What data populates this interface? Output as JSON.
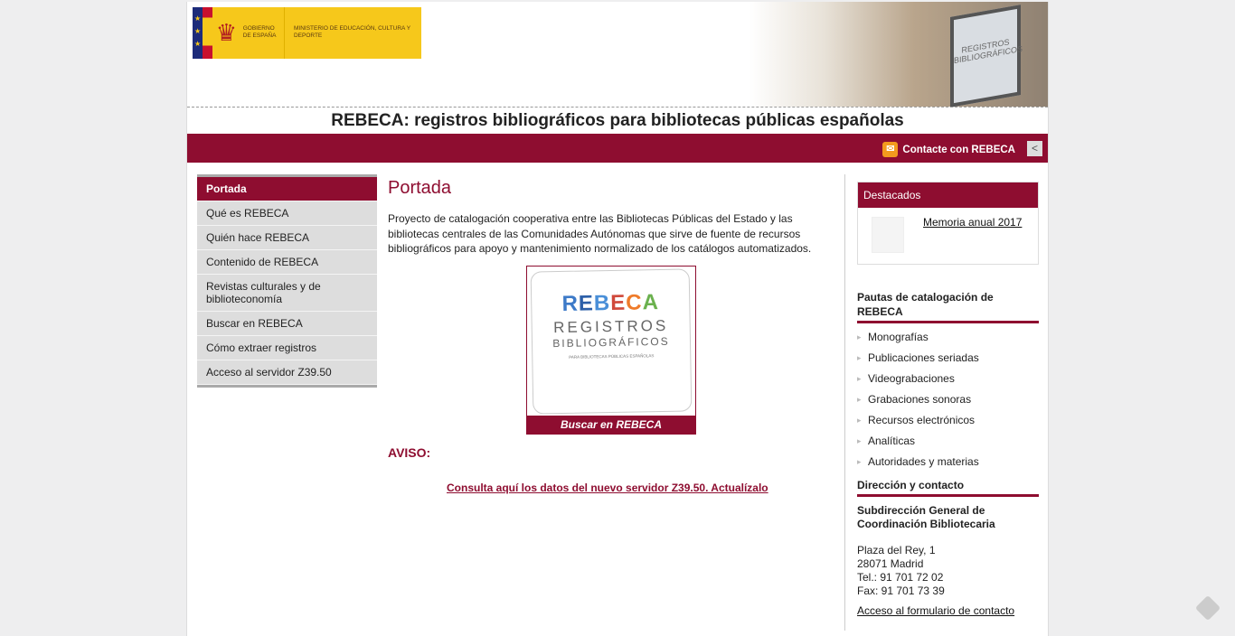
{
  "header": {
    "gov_line": "GOBIERNO DE ESPAÑA",
    "ministry": "MINISTERIO DE EDUCACIÓN, CULTURA Y DEPORTE",
    "photo_text": "REGISTROS BIBLIOGRÁFICOS",
    "title": "REBECA: registros bibliográficos para bibliotecas públicas españolas",
    "contact": "Contacte con REBECA"
  },
  "nav": [
    "Portada",
    "Qué es REBECA",
    "Quién hace REBECA",
    "Contenido de REBECA",
    "Revistas culturales y de biblioteconomía",
    "Buscar en REBECA",
    "Cómo extraer registros",
    "Acceso al servidor Z39.50"
  ],
  "main": {
    "title": "Portada",
    "intro": "Proyecto de catalogación cooperativa entre las Bibliotecas Públicas del Estado y las bibliotecas centrales de las Comunidades Autónomas que sirve de fuente de recursos bibliográficos para apoyo y mantenimiento normalizado de los catálogos automatizados.",
    "promo": {
      "rebeca": [
        "R",
        "E",
        "B",
        "E",
        "C",
        "A"
      ],
      "registros": "REGISTROS",
      "biblio": "BIBLIOGRÁFICOS",
      "sub": "PARA BIBLIOTECAS PÚBLICAS ESPAÑOLAS",
      "button": "Buscar en REBECA"
    },
    "aviso": "AVISO:",
    "link": "Consulta aquí los datos del nuevo servidor Z39.50. Actualízalo"
  },
  "side": {
    "destacados": "Destacados",
    "memoria": "Memoria anual 2017",
    "pautas_title": "Pautas de catalogación de REBECA",
    "pautas": [
      "Monografías",
      "Publicaciones seriadas",
      "Videograbaciones",
      "Grabaciones sonoras",
      "Recursos electrónicos",
      "Analíticas",
      "Autoridades y materias"
    ],
    "dir_title": "Dirección y contacto",
    "org": "Subdirección General de Coordinación Bibliotecaria",
    "addr1": "Plaza del Rey, 1",
    "addr2": "28071 Madrid",
    "tel": "Tel.: 91 701 72 02",
    "fax": "Fax: 91 701 73 39",
    "form": "Acceso al formulario de contacto"
  }
}
